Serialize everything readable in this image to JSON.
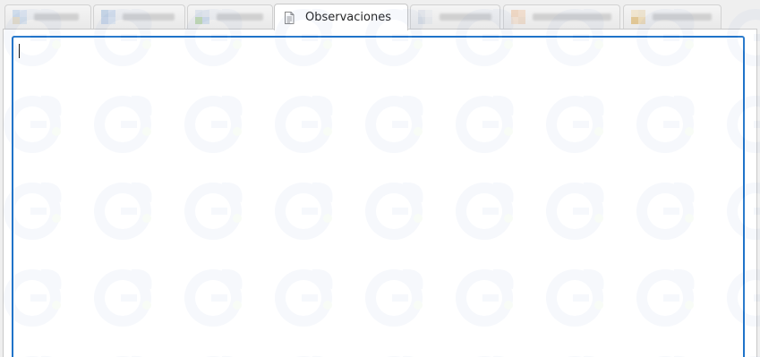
{
  "tabs": [
    {
      "label": "",
      "icon": "grid-icon",
      "colors": [
        "#a8c4e4",
        "#c9d9ee",
        "#d8c7a0",
        "#b8cde6"
      ],
      "active": false
    },
    {
      "label": "",
      "icon": "grid-icon",
      "colors": [
        "#8fb0d8",
        "#b4c9e6",
        "#9fbbe0",
        "#c3d4ec"
      ],
      "active": false
    },
    {
      "label": "",
      "icon": "grid-icon",
      "colors": [
        "#c8d4e4",
        "#d6dfea",
        "#8fc070",
        "#a9c4e2"
      ],
      "active": false
    },
    {
      "label": "Observaciones",
      "icon": "document-icon",
      "active": true
    },
    {
      "label": "",
      "icon": "grid-icon",
      "colors": [
        "#cfd6e2",
        "#e3e6ec",
        "#bfc9d8",
        "#d9dee6"
      ],
      "active": false
    },
    {
      "label": "",
      "icon": "grid-icon",
      "colors": [
        "#e9b68c",
        "#efc7a4",
        "#f0cfb2",
        "#e5c0a0"
      ],
      "active": false
    },
    {
      "label": "",
      "icon": "grid-icon",
      "colors": [
        "#f0d8a8",
        "#e7d2a6",
        "#d39a2c",
        "#e8c27a"
      ],
      "active": false
    }
  ],
  "observaciones": {
    "value": ""
  },
  "colors": {
    "focus_border": "#1f73c9",
    "watermark": "#4a78c8"
  }
}
